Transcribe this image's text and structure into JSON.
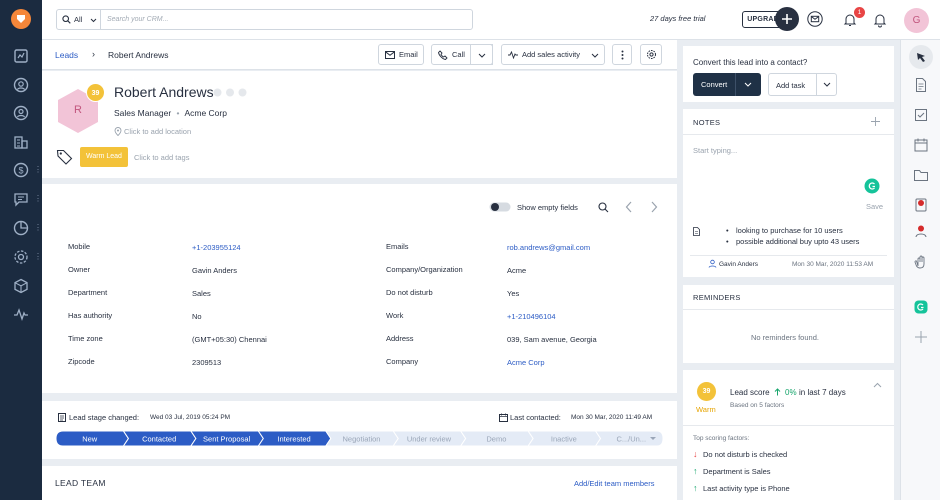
{
  "topbar": {
    "search_scope": "All",
    "search_placeholder": "Search your CRM...",
    "trial_text": "27 days free trial",
    "upgrade_label": "UPGRADE",
    "notification_count": "1",
    "user_initial": "G"
  },
  "header": {
    "breadcrumb_root": "Leads",
    "breadcrumb_current": "Robert Andrews",
    "email_label": "Email",
    "call_label": "Call",
    "sales_activity_label": "Add sales activity"
  },
  "profile": {
    "initial": "R",
    "score": "39",
    "name": "Robert Andrews",
    "title": "Sales Manager",
    "company": "Acme Corp",
    "location_placeholder": "Click to add location",
    "tag": "Warm Lead",
    "tags_placeholder": "Click to add tags"
  },
  "fields": {
    "show_empty_label": "Show empty fields",
    "left": [
      {
        "label": "Mobile",
        "value": "+1-203955124",
        "link": true
      },
      {
        "label": "Owner",
        "value": "Gavin Anders",
        "link": false
      },
      {
        "label": "Department",
        "value": "Sales",
        "link": false
      },
      {
        "label": "Has authority",
        "value": "No",
        "link": false
      },
      {
        "label": "Time zone",
        "value": "(GMT+05:30) Chennai",
        "link": false
      },
      {
        "label": "Zipcode",
        "value": "2309513",
        "link": false
      }
    ],
    "right": [
      {
        "label": "Emails",
        "value": "rob.andrews@gmail.com",
        "link": true
      },
      {
        "label": "Company/Organization",
        "value": "Acme",
        "link": false
      },
      {
        "label": "Do not disturb",
        "value": "Yes",
        "link": false
      },
      {
        "label": "Work",
        "value": "+1-210496104",
        "link": true
      },
      {
        "label": "Address",
        "value": "039, Sam avenue, Georgia",
        "link": false
      },
      {
        "label": "Company",
        "value": "Acme Corp",
        "link": true
      }
    ]
  },
  "stage": {
    "changed_label": "Lead stage changed:",
    "changed_date": "Wed 03 Jul, 2019 05:24 PM",
    "contacted_label": "Last contacted:",
    "contacted_date": "Mon 30 Mar, 2020 11:49 AM",
    "steps": [
      "New",
      "Contacted",
      "Sent Proposal",
      "Interested",
      "Negotiation",
      "Under review",
      "Demo",
      "Inactive",
      "C.../Un..."
    ],
    "active_count": 4
  },
  "lead_team": {
    "title": "LEAD TEAM",
    "action": "Add/Edit team members"
  },
  "convert": {
    "prompt": "Convert this lead into a contact?",
    "convert_label": "Convert",
    "task_label": "Add task"
  },
  "notes": {
    "title": "NOTES",
    "placeholder": "Start typing...",
    "save_label": "Save",
    "items": [
      "looking to purchase for 10 users",
      "possible additional buy upto 43 users"
    ],
    "author": "Gavin Anders",
    "timestamp": "Mon 30 Mar, 2020 11:53 AM"
  },
  "reminders": {
    "title": "REMINDERS",
    "empty": "No reminders found."
  },
  "lead_score": {
    "score": "39",
    "level": "Warm",
    "title": "Lead score",
    "change": "0%",
    "period": "in last 7 days",
    "basis": "Based on 5 factors",
    "factors_title": "Top scoring factors:",
    "factors": [
      {
        "text": "Do not disturb is checked",
        "direction": "down"
      },
      {
        "text": "Department is Sales",
        "direction": "up"
      },
      {
        "text": "Last activity type is Phone",
        "direction": "up"
      }
    ]
  },
  "colors": {
    "nav": "#1b2b40",
    "accent_blue": "#2c5cc5",
    "warm": "#f3c239",
    "dark_btn": "#283040"
  }
}
